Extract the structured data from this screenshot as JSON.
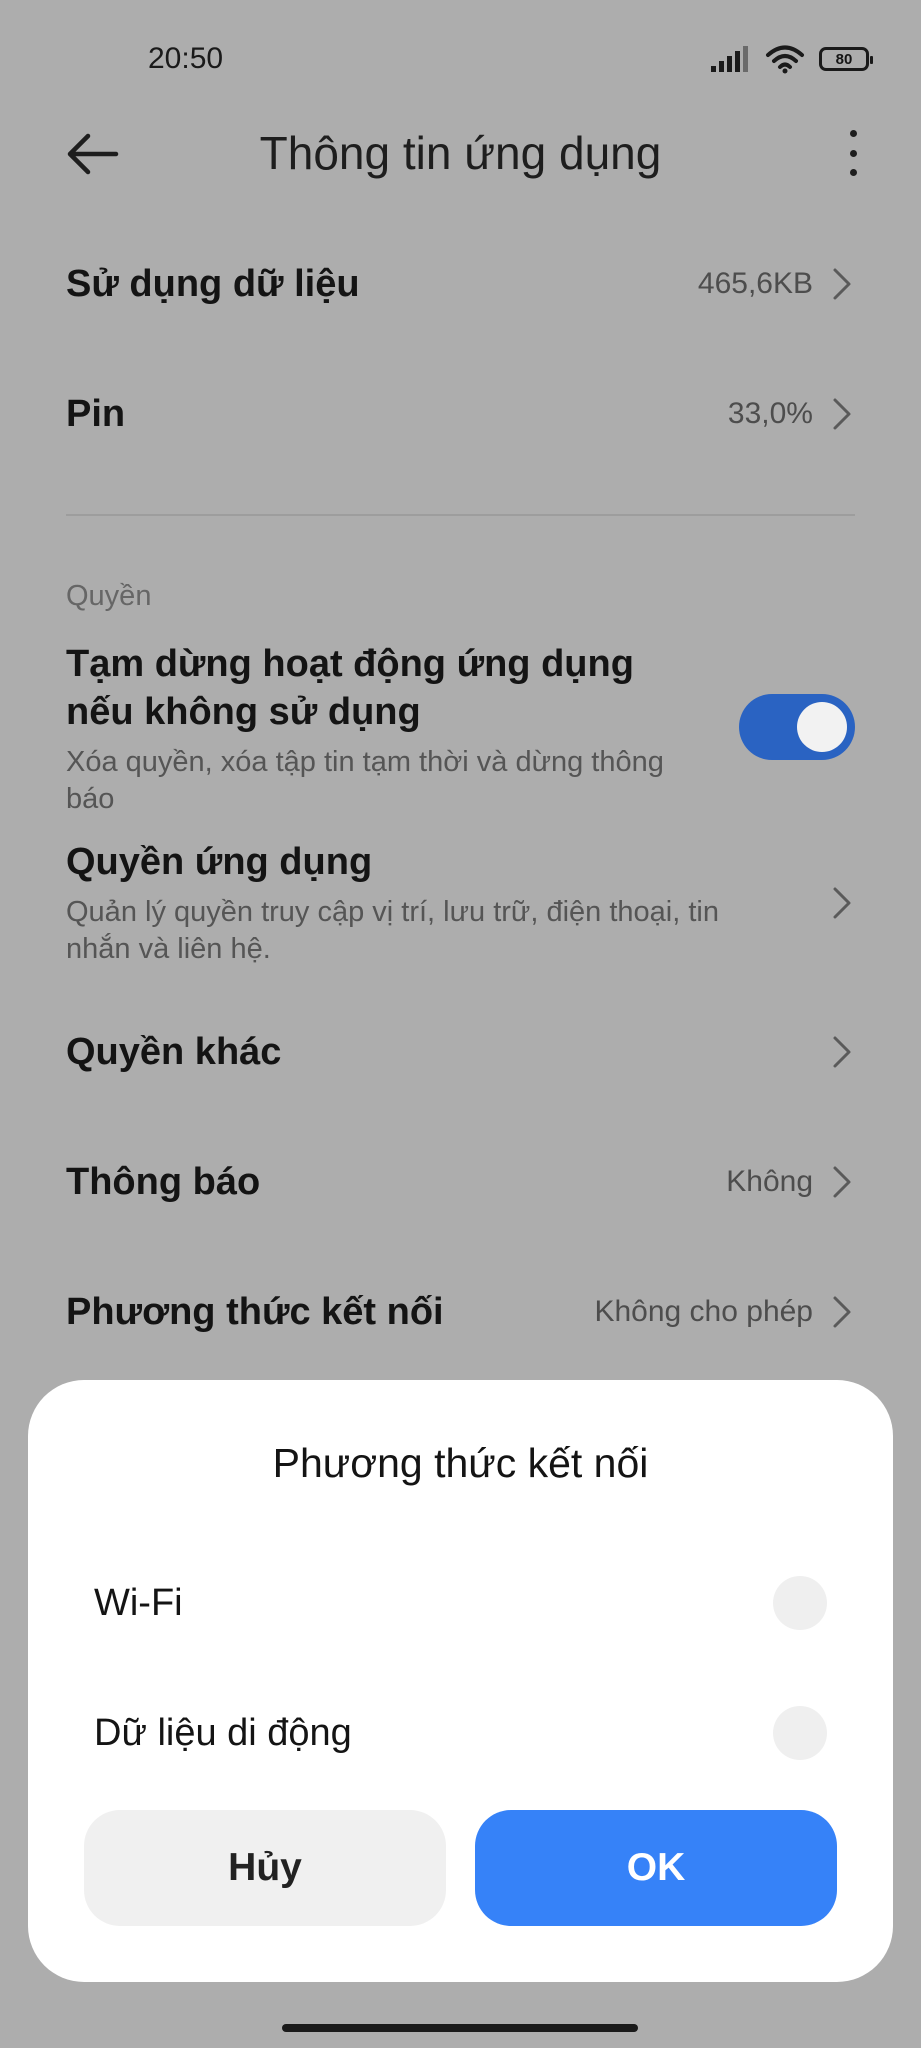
{
  "status_bar": {
    "time": "20:50",
    "battery": "80"
  },
  "header": {
    "title": "Thông tin ứng dụng"
  },
  "rows": {
    "data_usage": {
      "label": "Sử dụng dữ liệu",
      "value": "465,6KB"
    },
    "battery": {
      "label": "Pin",
      "value": "33,0%"
    }
  },
  "permissions": {
    "section_label": "Quyền",
    "pause_app": {
      "title": "Tạm dừng hoạt động ứng dụng nếu không sử dụng",
      "subtitle": "Xóa quyền, xóa tập tin tạm thời và dừng thông báo",
      "enabled": true
    },
    "app_permissions": {
      "title": "Quyền ứng dụng",
      "subtitle": "Quản lý quyền truy cập vị trí, lưu trữ, điện thoại, tin nhắn và liên hệ."
    },
    "other_permissions": {
      "label": "Quyền khác"
    },
    "notifications": {
      "label": "Thông báo",
      "value": "Không"
    },
    "connection": {
      "label": "Phương thức kết nối",
      "value": "Không cho phép"
    }
  },
  "dialog": {
    "title": "Phương thức kết nối",
    "options": [
      {
        "label": "Wi-Fi",
        "selected": false
      },
      {
        "label": "Dữ liệu di động",
        "selected": false
      }
    ],
    "cancel_label": "Hủy",
    "ok_label": "OK"
  },
  "colors": {
    "accent": "#3682f8",
    "toggle_on": "#2a63c2",
    "backdrop": "#adadad"
  }
}
